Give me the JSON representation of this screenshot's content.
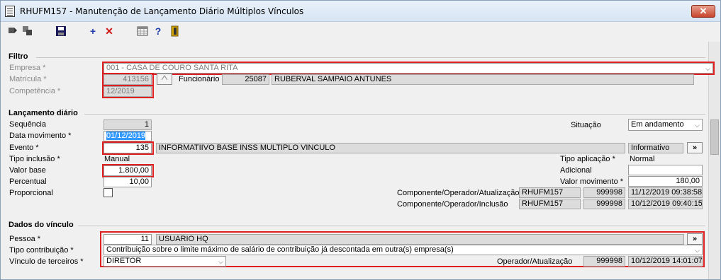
{
  "window": {
    "title": "RHUFM157 - Manutenção de Lançamento Diário Múltiplos Vínculos",
    "close": "✕"
  },
  "toolbar": {
    "new": "+",
    "delete": "✕",
    "help": "?"
  },
  "filtro": {
    "title": "Filtro",
    "empresa_label": "Empresa *",
    "empresa_value": "001 - CASA DE COURO SANTA RITA",
    "matricula_label": "Matrícula *",
    "matricula_value": "413156",
    "funcionario_label": "Funcionário",
    "funcionario_code": "25087",
    "funcionario_name": "RUBERVAL SAMPAIO ANTUNES",
    "competencia_label": "Competência *",
    "competencia_value": "12/2019"
  },
  "lancamento": {
    "title": "Lançamento diário",
    "sequencia_label": "Sequência",
    "sequencia_value": "1",
    "data_label": "Data movimento *",
    "data_value": "01/12/2019",
    "evento_label": "Evento *",
    "evento_code": "135",
    "evento_desc": "INFORMATIIVO BASE INSS MULTIPLO VINCULO",
    "evento_tipo": "Informativo",
    "tipo_inclusao_label": "Tipo inclusão *",
    "tipo_inclusao_value": "Manual",
    "valor_base_label": "Valor base",
    "valor_base_value": "1.800,00",
    "percentual_label": "Percentual",
    "percentual_value": "10,00",
    "proporcional_label": "Proporcional",
    "situacao_label": "Situação",
    "situacao_value": "Em andamento",
    "tipo_aplicacao_label": "Tipo aplicação *",
    "tipo_aplicacao_value": "Normal",
    "adicional_label": "Adicional",
    "adicional_value": "",
    "valor_mov_label": "Valor movimento *",
    "valor_mov_value": "180,00",
    "comp_atual_label": "Componente/Operador/Atualização",
    "comp_atual_comp": "RHUFM157",
    "comp_atual_op": "999998",
    "comp_atual_dt": "11/12/2019 09:38:58",
    "comp_incl_label": "Componente/Operador/Inclusão",
    "comp_incl_comp": "RHUFM157",
    "comp_incl_op": "999998",
    "comp_incl_dt": "10/12/2019 09:40:15",
    "more_button": "»"
  },
  "vinculo": {
    "title": "Dados do vínculo",
    "pessoa_label": "Pessoa *",
    "pessoa_code": "11",
    "pessoa_name": "USUARIO HQ",
    "tipo_contrib_label": "Tipo contribuição *",
    "tipo_contrib_value": "Contribuição sobre o limite máximo de salário de contribuição já descontada em outra(s) empresa(s)",
    "vinculo_terceiros_label": "Vínculo de terceiros *",
    "vinculo_terceiros_value": "DIRETOR",
    "op_atual_label": "Operador/Atualização",
    "op_atual_op": "999998",
    "op_atual_dt": "10/12/2019 14:01:07",
    "more_button": "»"
  },
  "colors": {
    "highlight": "#e02020",
    "selection": "#3399ff",
    "readonly": "#dcdcdc"
  }
}
